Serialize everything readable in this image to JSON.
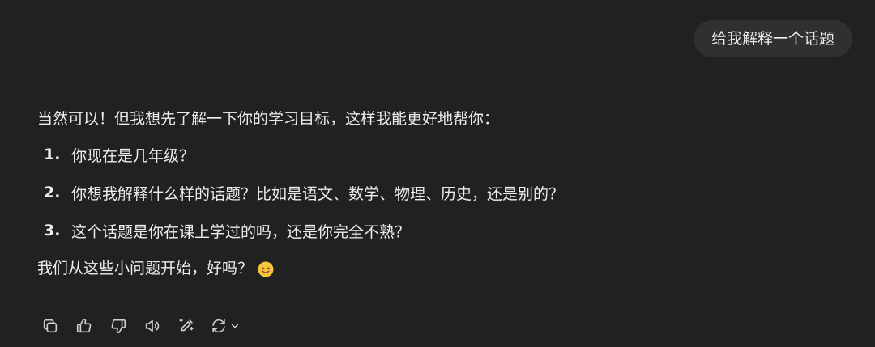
{
  "user_message": "给我解释一个话题",
  "assistant": {
    "intro": "当然可以！但我想先了解一下你的学习目标，这样我能更好地帮你：",
    "questions": [
      {
        "num": "1.",
        "text": "你现在是几年级？"
      },
      {
        "num": "2.",
        "text": "你想我解释什么样的话题？比如是语文、数学、物理、历史，还是别的？"
      },
      {
        "num": "3.",
        "text": "这个话题是你在课上学过的吗，还是你完全不熟？"
      }
    ],
    "outro": "我们从这些小问题开始，好吗？"
  },
  "toolbar": {
    "icons": [
      "copy-icon",
      "thumbs-up-icon",
      "thumbs-down-icon",
      "read-aloud-icon",
      "edit-icon",
      "regenerate-icon",
      "chevron-down-icon"
    ]
  },
  "colors": {
    "background": "#212121",
    "bubble": "#303030",
    "text": "#ececec",
    "icon": "#cfcfcf"
  }
}
